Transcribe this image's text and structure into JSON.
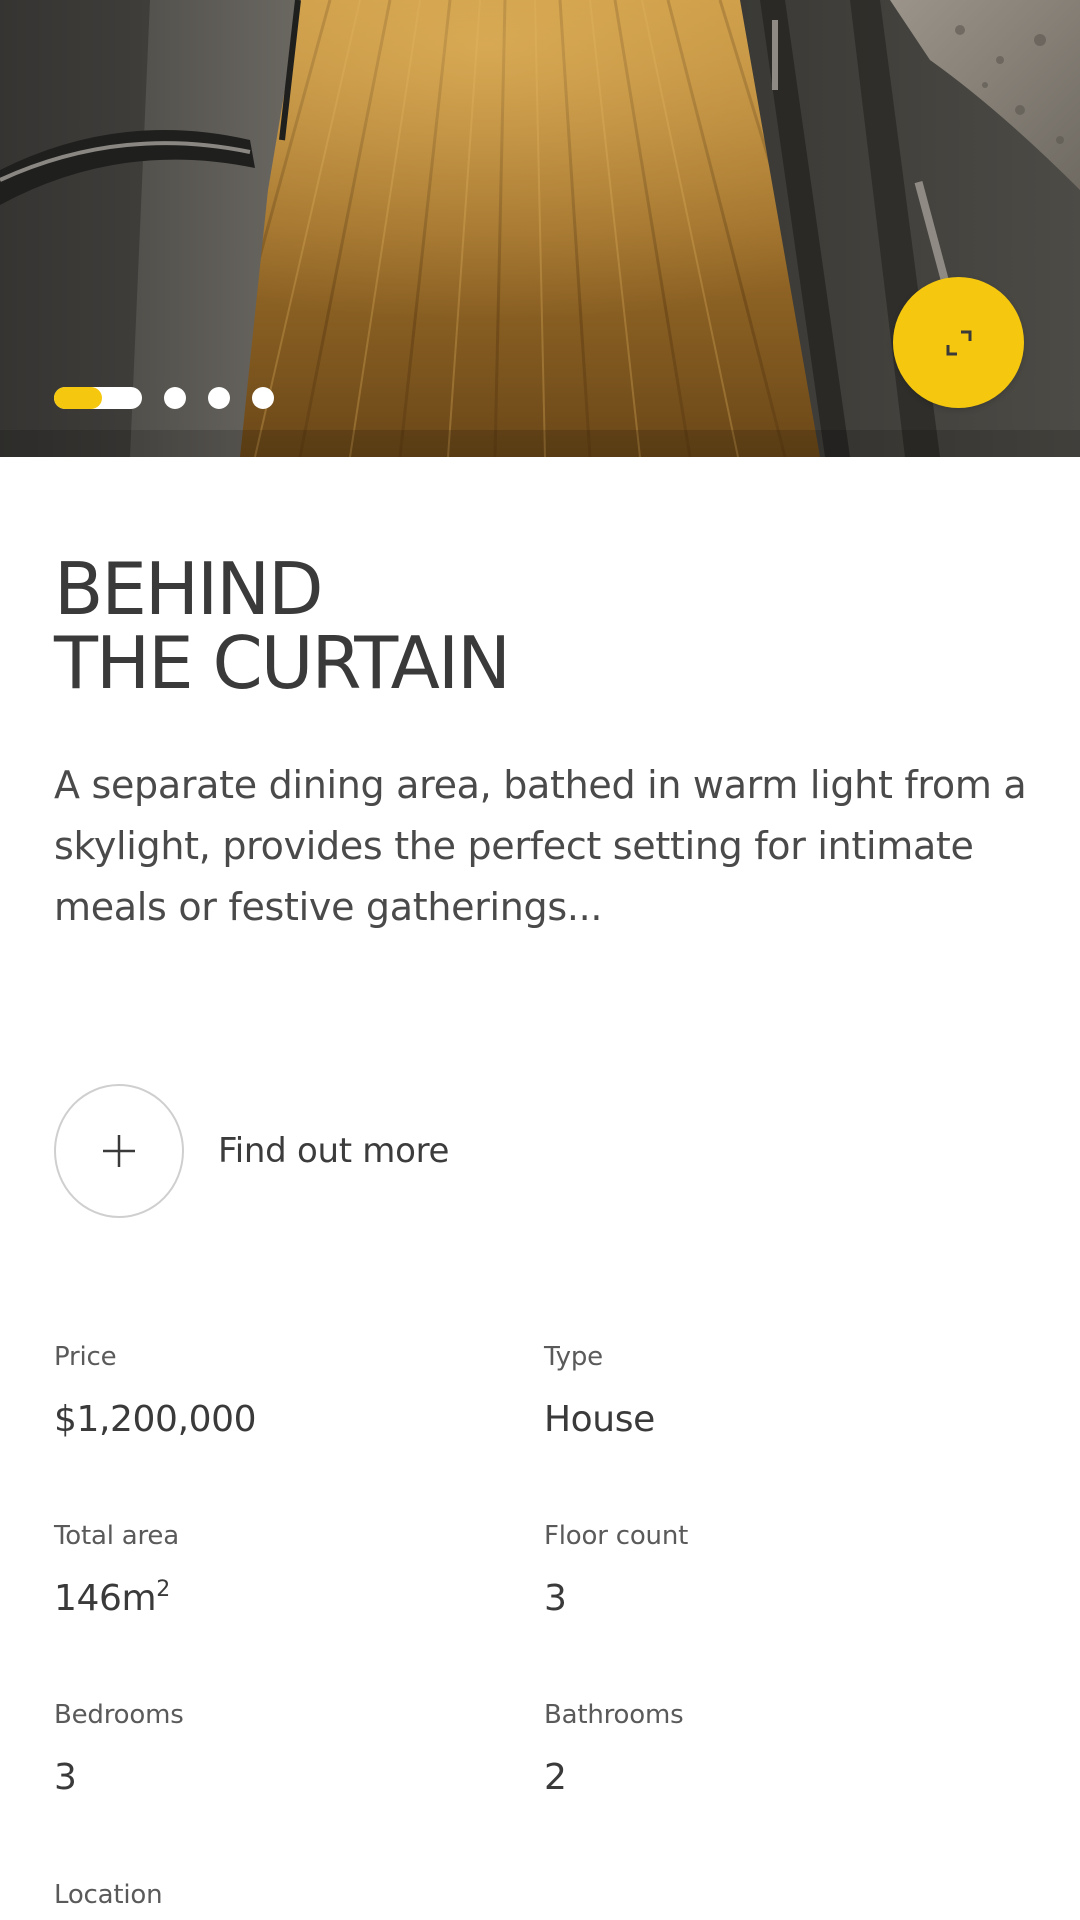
{
  "gallery": {
    "slide_count": 4,
    "active_index": 0,
    "active_progress": 0.55,
    "expand_icon": "expand-icon"
  },
  "listing": {
    "title_line1": "BEHIND",
    "title_line2": "THE CURTAIN",
    "description": "A separate dining area, bathed in warm light from a skylight, provides the perfect setting for intimate meals or festive gatherings..."
  },
  "cta": {
    "icon": "plus-icon",
    "label": "Find out more"
  },
  "specs": {
    "price_label": "Price",
    "price_value": "$1,200,000",
    "type_label": "Type",
    "type_value": "House",
    "area_label": "Total area",
    "area_value": "146m",
    "area_unit_sup": "2",
    "floors_label": "Floor count",
    "floors_value": "3",
    "bedrooms_label": "Bedrooms",
    "bedrooms_value": "3",
    "bathrooms_label": "Bathrooms",
    "bathrooms_value": "2",
    "location_label": "Location"
  },
  "colors": {
    "accent": "#f5c80f",
    "text": "#3a3a3a",
    "muted": "#5a5a5a",
    "background": "#ffffff"
  }
}
